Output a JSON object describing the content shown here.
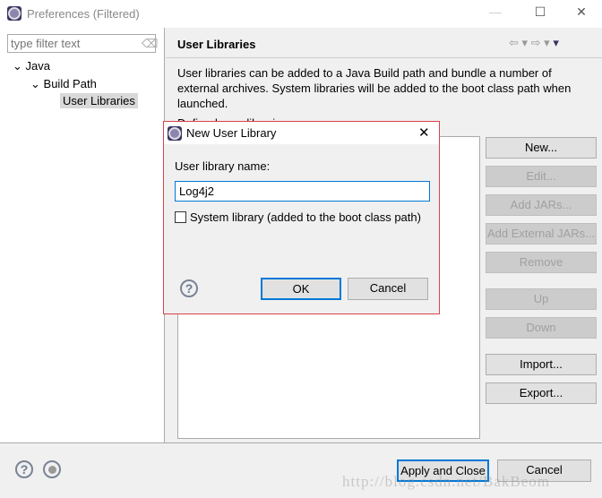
{
  "window": {
    "title": "Preferences (Filtered)",
    "minimize": "—",
    "maximize": "☐",
    "close": "✕"
  },
  "filter": {
    "placeholder": "type filter text"
  },
  "tree": [
    {
      "label": "Java"
    },
    {
      "label": "Build Path"
    },
    {
      "label": "User Libraries"
    }
  ],
  "page": {
    "title": "User Libraries",
    "description": "User libraries can be added to a Java Build path and bundle a number of external archives. System libraries will be added to the boot class path when launched.",
    "list_label": "Defined user libraries:"
  },
  "buttons": [
    {
      "label": "New...",
      "enabled": true
    },
    {
      "label": "Edit...",
      "enabled": false
    },
    {
      "label": "Add JARs...",
      "enabled": false
    },
    {
      "label": "Add External JARs...",
      "enabled": false
    },
    {
      "label": "Remove",
      "enabled": false
    },
    {
      "label": "Up",
      "enabled": false
    },
    {
      "label": "Down",
      "enabled": false
    },
    {
      "label": "Import...",
      "enabled": true
    },
    {
      "label": "Export...",
      "enabled": true
    }
  ],
  "dialog": {
    "title": "New User Library",
    "name_label": "User library name:",
    "name_value": "Log4j2",
    "system_checkbox": "System library (added to the boot class path)",
    "system_checked": false,
    "ok": "OK",
    "cancel": "Cancel"
  },
  "footer": {
    "apply": "Apply and Close",
    "cancel": "Cancel"
  },
  "watermark": "http://blog.csdn.net/BakBeom"
}
